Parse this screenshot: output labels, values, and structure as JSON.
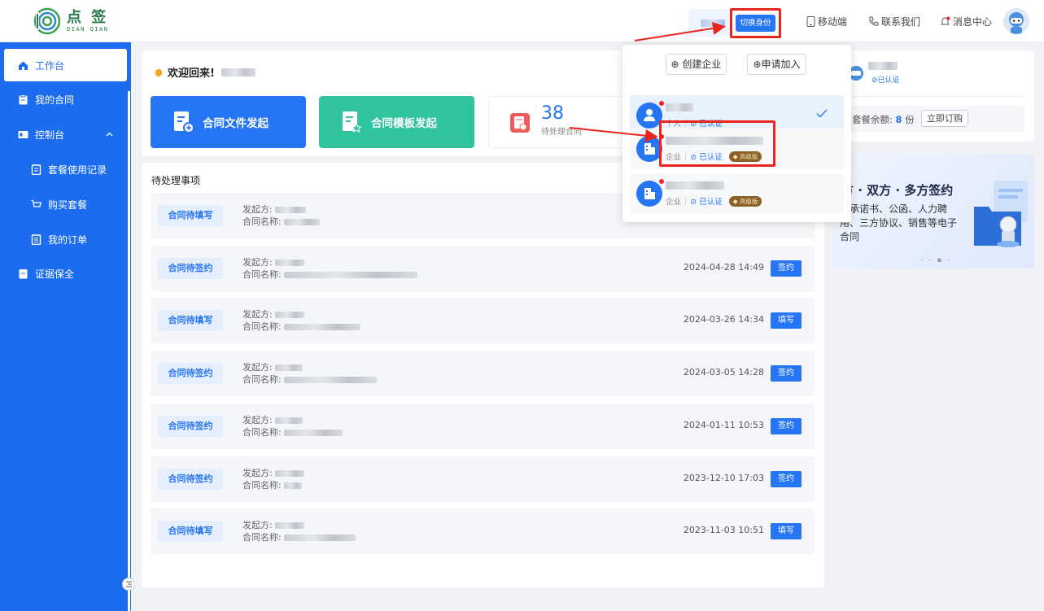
{
  "header": {
    "logo_cn": "点 签",
    "logo_en": "DIAN QIAN",
    "switch_identity": "切换身份",
    "nav": {
      "mobile": "移动端",
      "contact": "联系我们",
      "messages": "消息中心"
    }
  },
  "sidebar": {
    "items": [
      {
        "label": "工作台",
        "icon": "home-icon"
      },
      {
        "label": "我的合同",
        "icon": "clipboard-icon"
      },
      {
        "label": "控制台",
        "icon": "console-icon"
      },
      {
        "label": "套餐使用记录",
        "icon": "record-icon"
      },
      {
        "label": "购买套餐",
        "icon": "cart-icon"
      },
      {
        "label": "我的订单",
        "icon": "order-icon"
      },
      {
        "label": "证据保全",
        "icon": "evidence-icon"
      }
    ]
  },
  "welcome": {
    "text": "欢迎回来!",
    "tiles": [
      {
        "label": "合同文件发起",
        "color": "#2575f4"
      },
      {
        "label": "合同模板发起",
        "color": "#2fc3a0"
      }
    ],
    "pending_count": "38",
    "pending_label": "待处理合同"
  },
  "todo": {
    "title": "待处理事项",
    "initiator_label": "发起方:",
    "contract_label": "合同名称:",
    "rows": [
      {
        "tag": "合同待填写",
        "time": "",
        "action": ""
      },
      {
        "tag": "合同待签约",
        "time": "2024-04-28 14:49",
        "action": "签约"
      },
      {
        "tag": "合同待填写",
        "time": "2024-03-26 14:34",
        "action": "填写"
      },
      {
        "tag": "合同待签约",
        "time": "2024-03-05 14:28",
        "action": "签约"
      },
      {
        "tag": "合同待签约",
        "time": "2024-01-11 10:53",
        "action": "签约"
      },
      {
        "tag": "合同待签约",
        "time": "2023-12-10 17:03",
        "action": "签约"
      },
      {
        "tag": "合同待填写",
        "time": "2023-11-03 10:51",
        "action": "填写"
      }
    ]
  },
  "profile": {
    "verified": "已认证",
    "quota_label": "套餐余额:",
    "quota_value": "8",
    "quota_unit": "份",
    "subscribe": "立即订购"
  },
  "banner": {
    "title": "方 · 双方 · 多方签约",
    "subtitle": "起承诺书、公函、人力聘用、三方协议、销售等电子合同",
    "dots": "- - ▪ -"
  },
  "dropdown": {
    "create_company": "创建企业",
    "apply_join": "申请加入",
    "accounts": [
      {
        "type": "个人",
        "cert": "已认证",
        "badge": "",
        "selected": true
      },
      {
        "type": "企业",
        "cert": "已认证",
        "badge": "高级版",
        "selected": false
      },
      {
        "type": "企业",
        "cert": "已认证",
        "badge": "高级版",
        "selected": false
      }
    ]
  },
  "colors": {
    "primary": "#2575f4",
    "sidebar": "#1c6cf0",
    "teal": "#2fc3a0",
    "highlight": "#e8261d"
  }
}
